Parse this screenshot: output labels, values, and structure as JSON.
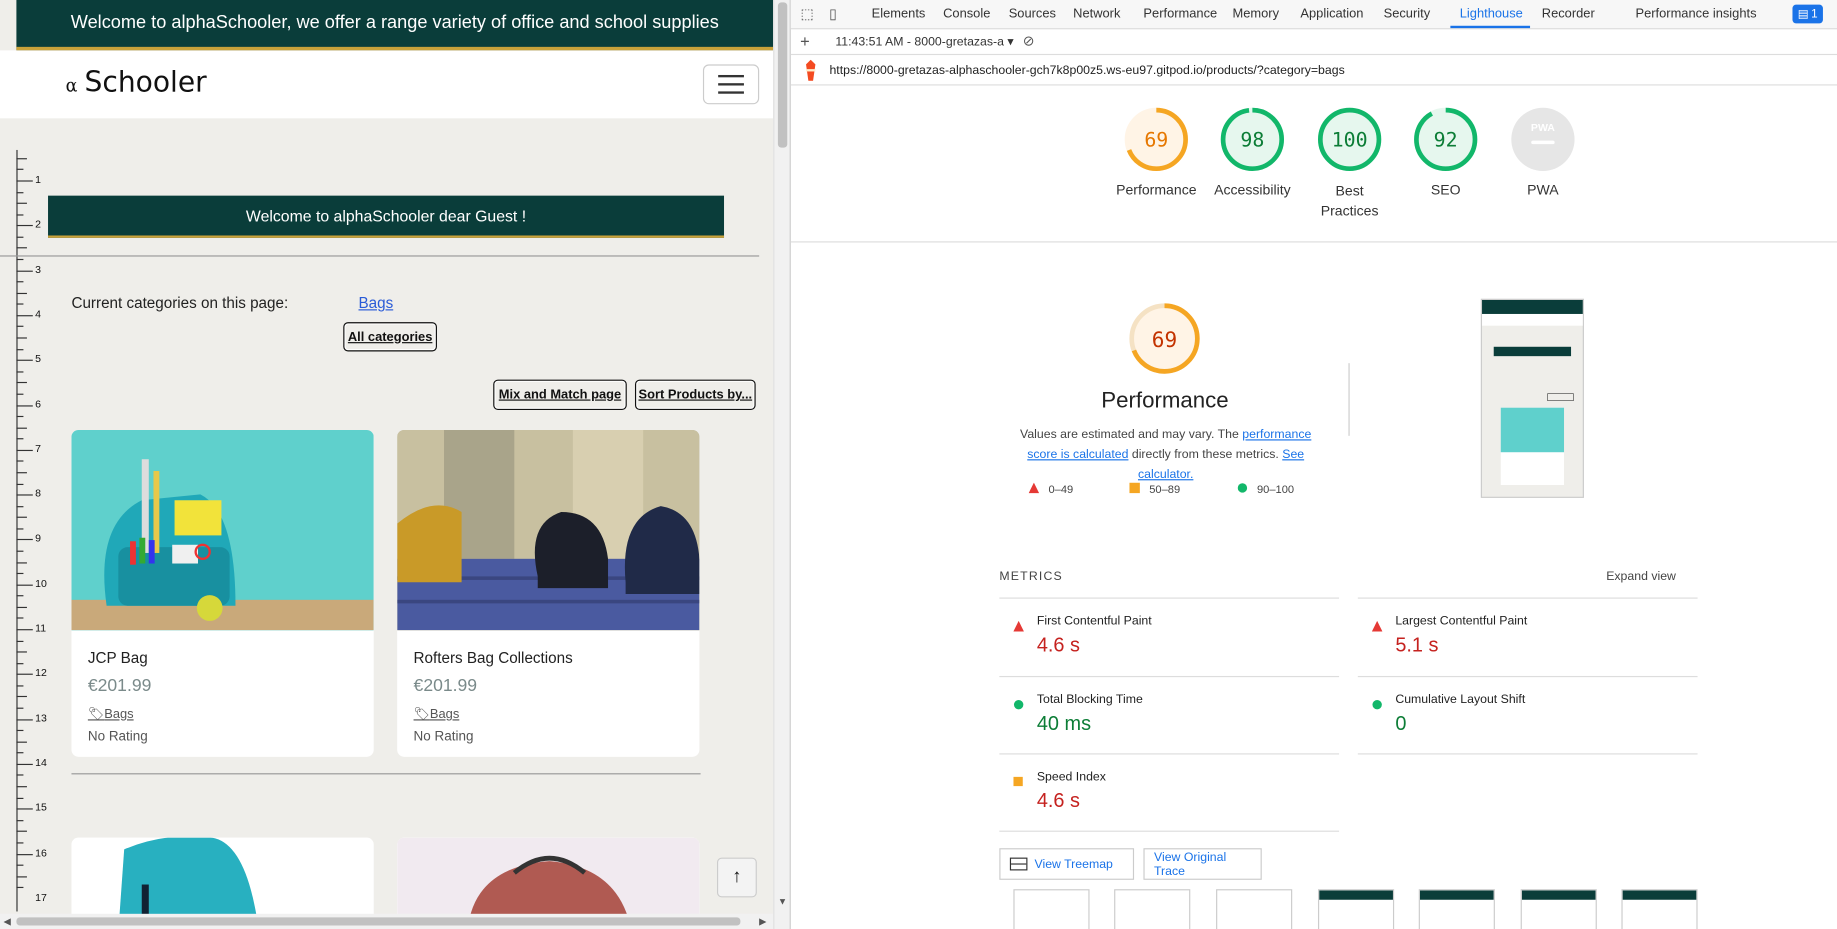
{
  "left": {
    "banner": "Welcome to alphaSchooler, we offer a range variety of office and school supplies",
    "logo_symbol": "α",
    "logo_text": "Schooler",
    "greeting": "Welcome to alphaSchooler dear Guest !",
    "categories_label": "Current categories on this page:",
    "category_link": "Bags",
    "all_categories": "All categories",
    "mix_match": "Mix and Match page",
    "sort_products": "Sort Products by...",
    "ruler_numbers": [
      "1",
      "2",
      "3",
      "4",
      "5",
      "6",
      "7",
      "8",
      "9",
      "10",
      "11",
      "12",
      "13",
      "14",
      "15",
      "16",
      "17"
    ],
    "products": [
      {
        "name": "JCP Bag",
        "price": "€201.99",
        "tag": "Bags",
        "rating": "No Rating"
      },
      {
        "name": "Rofters Bag Collections",
        "price": "€201.99",
        "tag": "Bags",
        "rating": "No Rating"
      }
    ],
    "up_arrow": "↑"
  },
  "devtools": {
    "tabs": [
      "Elements",
      "Console",
      "Sources",
      "Network",
      "Performance",
      "Memory",
      "Application",
      "Security",
      "Lighthouse",
      "Recorder",
      "Performance insights"
    ],
    "active_tab": "Lighthouse",
    "badge": "1",
    "time_report": "11:43:51 AM - 8000-gretazas-a",
    "url": "https://8000-gretazas-alphaschooler-gch7k8p00z5.ws-eu97.gitpod.io/products/?category=bags",
    "scores": [
      {
        "value": "69",
        "label": "Performance",
        "color": "#e67700"
      },
      {
        "value": "98",
        "label": "Accessibility",
        "color": "#0c7d36"
      },
      {
        "value": "100",
        "label": "Best Practices",
        "color": "#0c7d36"
      },
      {
        "value": "92",
        "label": "SEO",
        "color": "#0c7d36"
      },
      {
        "value": "PWA",
        "label": "PWA",
        "color": "#999999"
      }
    ],
    "perf": {
      "score": "69",
      "title": "Performance",
      "note_start": "Values are estimated and may vary. The ",
      "note_link1": "performance score is calculated",
      "note_mid": " directly from these metrics. ",
      "note_link2": "See calculator."
    },
    "legend": [
      "0–49",
      "50–89",
      "90–100"
    ],
    "metrics_heading": "METRICS",
    "expand_view": "Expand view",
    "metrics": [
      {
        "name": "First Contentful Paint",
        "value": "4.6 s",
        "status": "fail"
      },
      {
        "name": "Largest Contentful Paint",
        "value": "5.1 s",
        "status": "fail"
      },
      {
        "name": "Total Blocking Time",
        "value": "40 ms",
        "status": "pass"
      },
      {
        "name": "Cumulative Layout Shift",
        "value": "0",
        "status": "pass"
      },
      {
        "name": "Speed Index",
        "value": "4.6 s",
        "status": "average"
      }
    ],
    "view_treemap": "View Treemap",
    "view_trace": "View Original Trace",
    "colors": {
      "fail": "#e53935",
      "average": "#f5a623",
      "pass": "#12b76a",
      "fail_text": "#c5221f",
      "pass_text": "#0c7d36"
    }
  }
}
